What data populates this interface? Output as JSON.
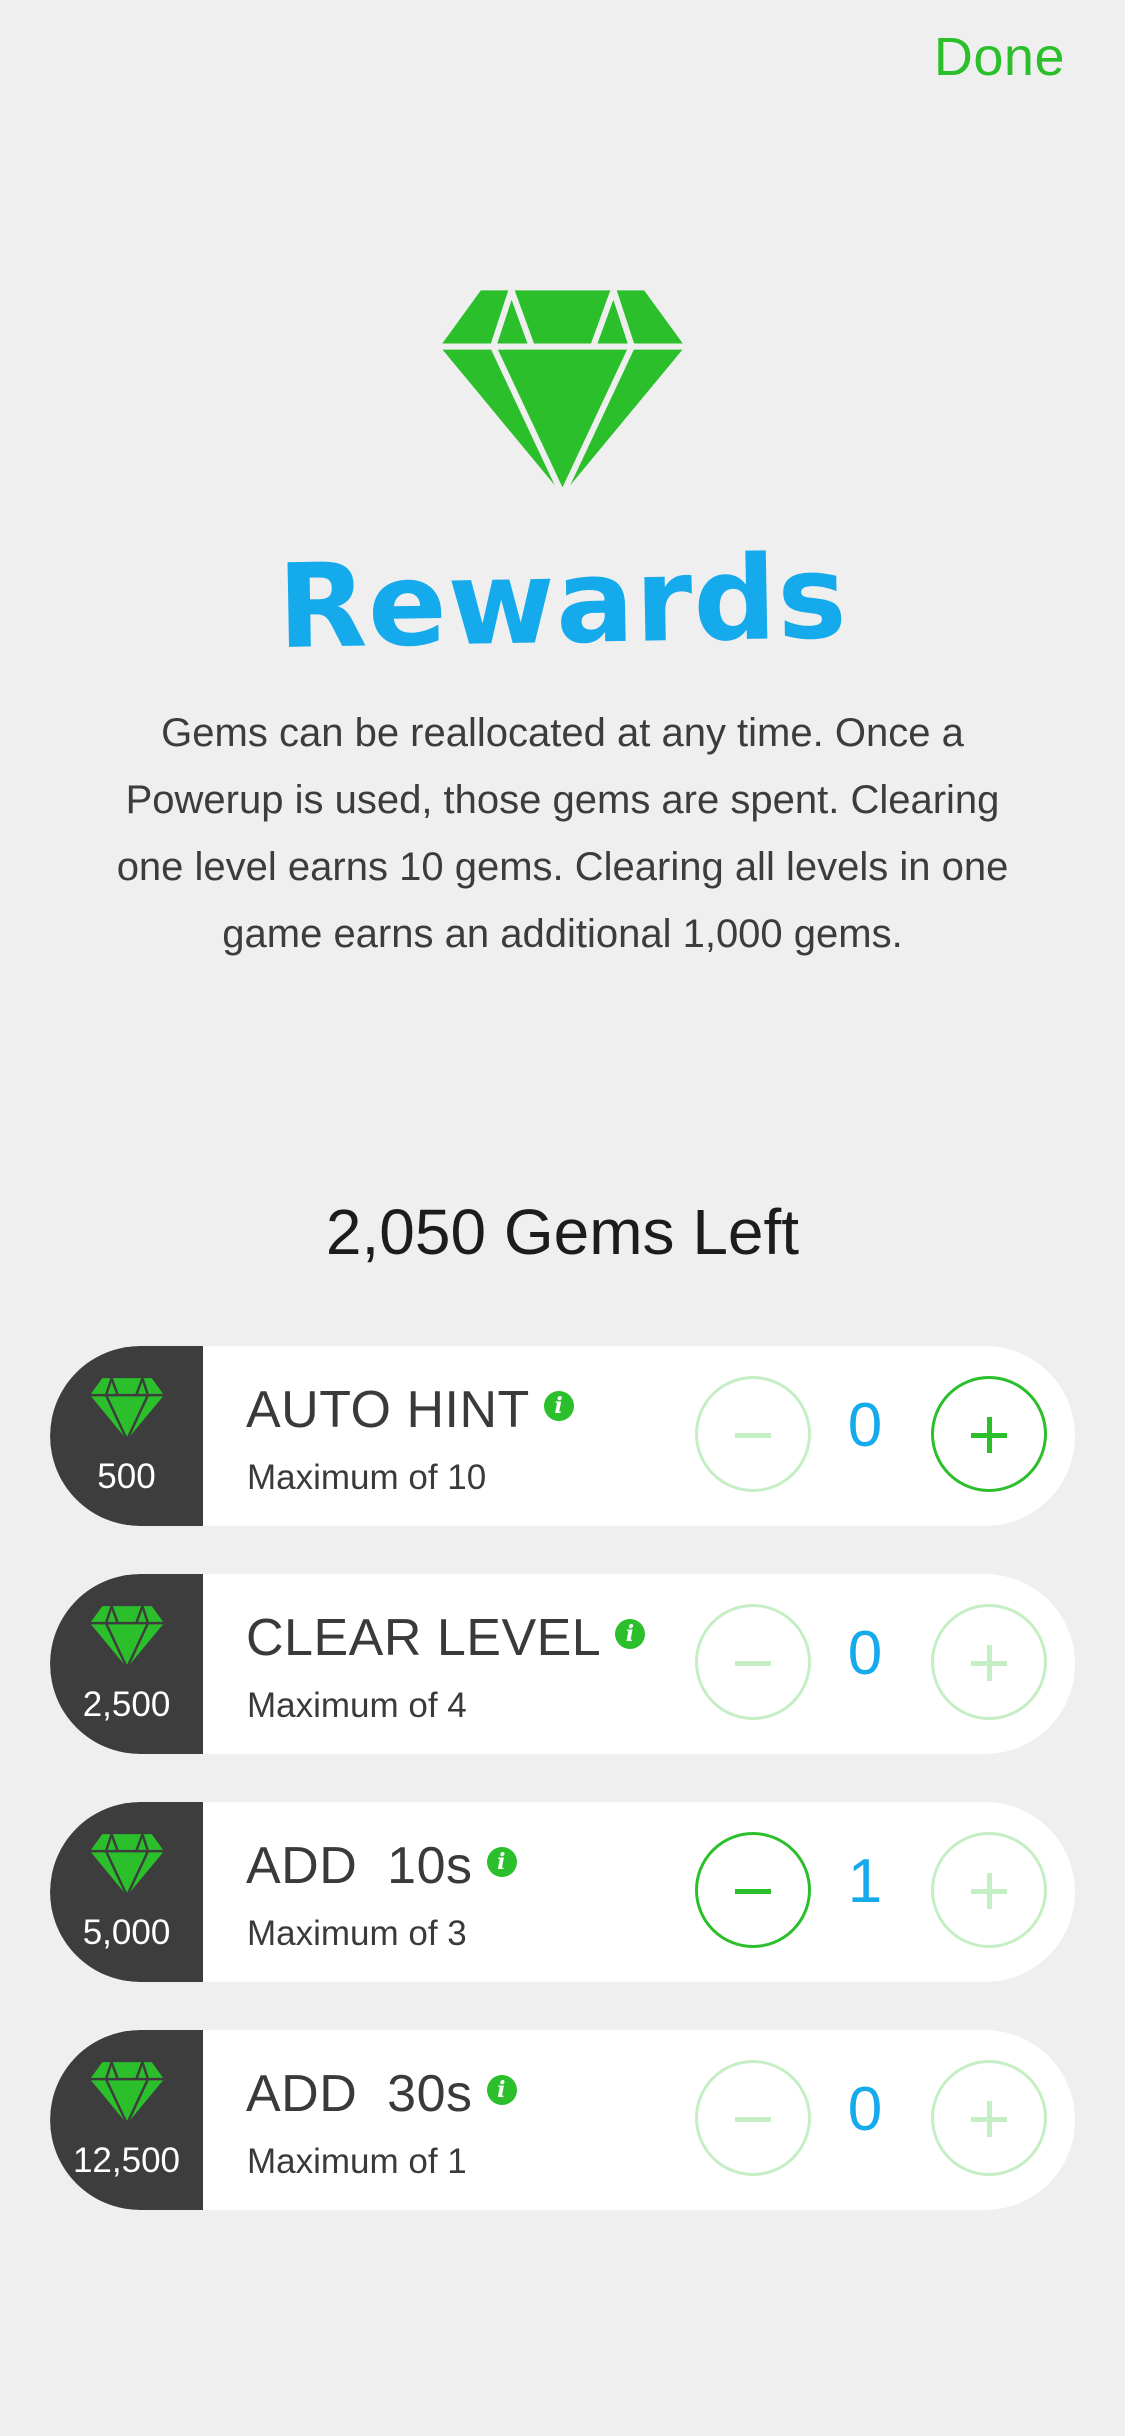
{
  "header": {
    "done_label": "Done"
  },
  "hero": {
    "icon": "gem-icon",
    "title": "Rewards",
    "description": "Gems can be reallocated at any time. Once a Powerup is used, those gems are spent. Clearing one level earns 10 gems. Clearing all levels in one game earns an additional 1,000 gems."
  },
  "summary": {
    "gems_left": "2,050 Gems Left"
  },
  "powerups": [
    {
      "cost": "500",
      "name": "AUTO HINT",
      "max": "Maximum of 10",
      "quantity": "0",
      "minus_enabled": false,
      "plus_enabled": true
    },
    {
      "cost": "2,500",
      "name": "CLEAR LEVEL",
      "max": "Maximum of 4",
      "quantity": "0",
      "minus_enabled": false,
      "plus_enabled": false
    },
    {
      "cost": "5,000",
      "name": "ADD  10s",
      "max": "Maximum of 3",
      "quantity": "1",
      "minus_enabled": true,
      "plus_enabled": false
    },
    {
      "cost": "12,500",
      "name": "ADD  30s",
      "max": "Maximum of 1",
      "quantity": "0",
      "minus_enabled": false,
      "plus_enabled": false
    }
  ],
  "colors": {
    "accent_green": "#2bbf2b",
    "disabled_green": "#c5eec5",
    "title_blue": "#14aaeb",
    "cost_panel": "#3d3d3d",
    "background": "#efefef"
  }
}
